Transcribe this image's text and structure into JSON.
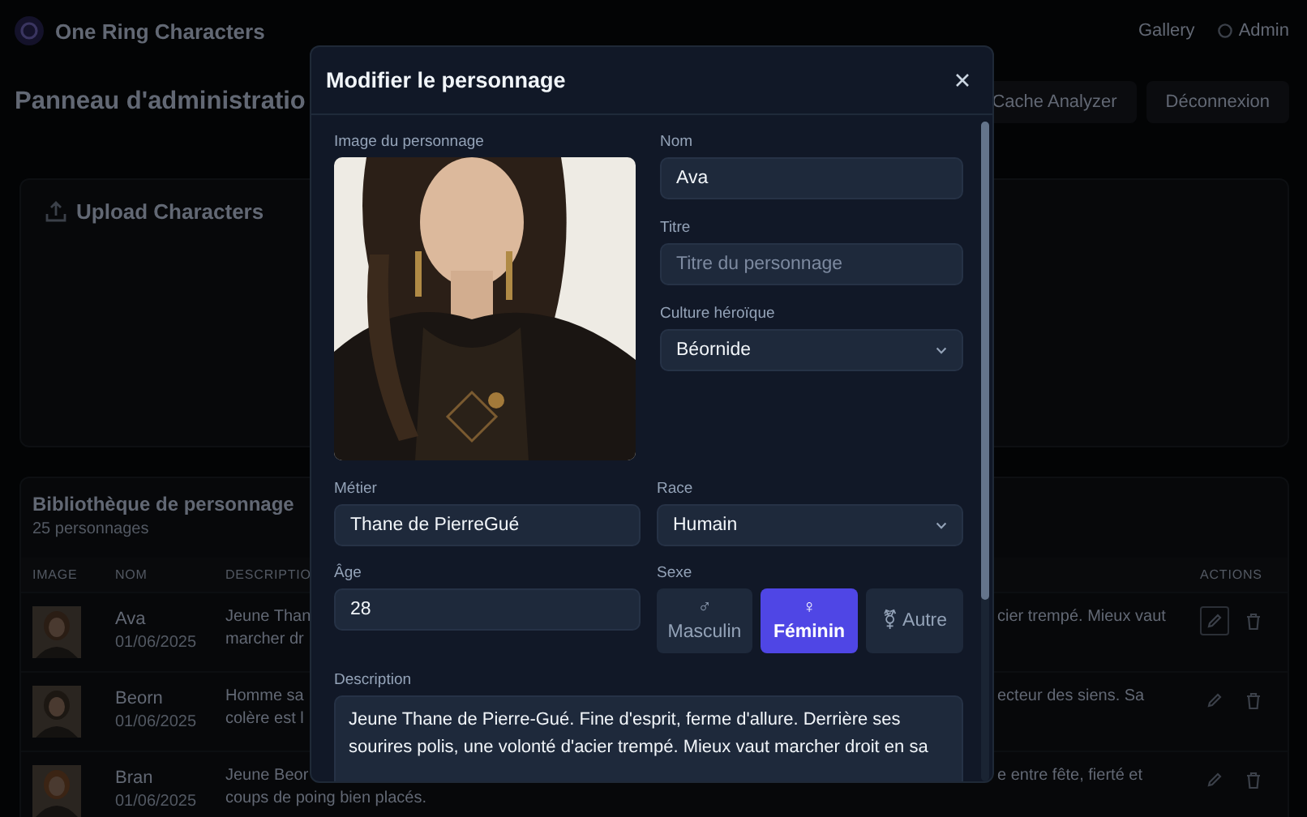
{
  "header": {
    "brand": "One Ring Characters",
    "nav": [
      {
        "kind": "link",
        "label": "Gallery"
      },
      {
        "kind": "user",
        "label": "Admin"
      }
    ]
  },
  "admin": {
    "title": "Panneau d'administratio",
    "buttons": [
      "Cache Analyzer",
      "Déconnexion"
    ]
  },
  "upload": {
    "title": "Upload Characters"
  },
  "library": {
    "title": "Bibliothèque de personnage",
    "count": "25 personnages",
    "columns": [
      "IMAGE",
      "NOM",
      "DESCRIPTIO",
      "ACTIONS"
    ],
    "rows": [
      {
        "name": "Ava",
        "date": "01/06/2025",
        "description_left": [
          "Jeune Than",
          "marcher dr"
        ],
        "description_right": [
          "cier trempé. Mieux vaut"
        ],
        "focused": true
      },
      {
        "name": "Beorn",
        "date": "01/06/2025",
        "description_left": [
          "Homme sa",
          "colère est l"
        ],
        "description_right": [
          "ecteur des siens. Sa"
        ],
        "focused": false
      },
      {
        "name": "Bran",
        "date": "01/06/2025",
        "description_left": [
          "Jeune Beor",
          "coups de poing bien placés."
        ],
        "description_right": [
          "e entre fête, fierté et"
        ],
        "focused": false
      }
    ]
  },
  "modal": {
    "title": "Modifier le personnage",
    "image_label": "Image du personnage",
    "name": {
      "label": "Nom",
      "value": "Ava"
    },
    "title_field": {
      "label": "Titre",
      "placeholder": "Titre du personnage"
    },
    "culture": {
      "label": "Culture héroïque",
      "value": "Béornide"
    },
    "job": {
      "label": "Métier",
      "value": "Thane de PierreGué"
    },
    "race": {
      "label": "Race",
      "value": "Humain"
    },
    "age": {
      "label": "Âge",
      "value": "28"
    },
    "sex": {
      "label": "Sexe",
      "options": [
        {
          "symbol": "♂",
          "label": "Masculin",
          "selected": false
        },
        {
          "symbol": "♀",
          "label": "Féminin",
          "selected": true
        },
        {
          "symbol": "⚧",
          "label": "Autre",
          "selected": false
        }
      ]
    },
    "description": {
      "label": "Description",
      "value": "Jeune Thane de Pierre-Gué. Fine d'esprit, ferme d'allure. Derrière ses sourires polis, une volonté d'acier trempé. Mieux vaut marcher droit en sa"
    }
  }
}
